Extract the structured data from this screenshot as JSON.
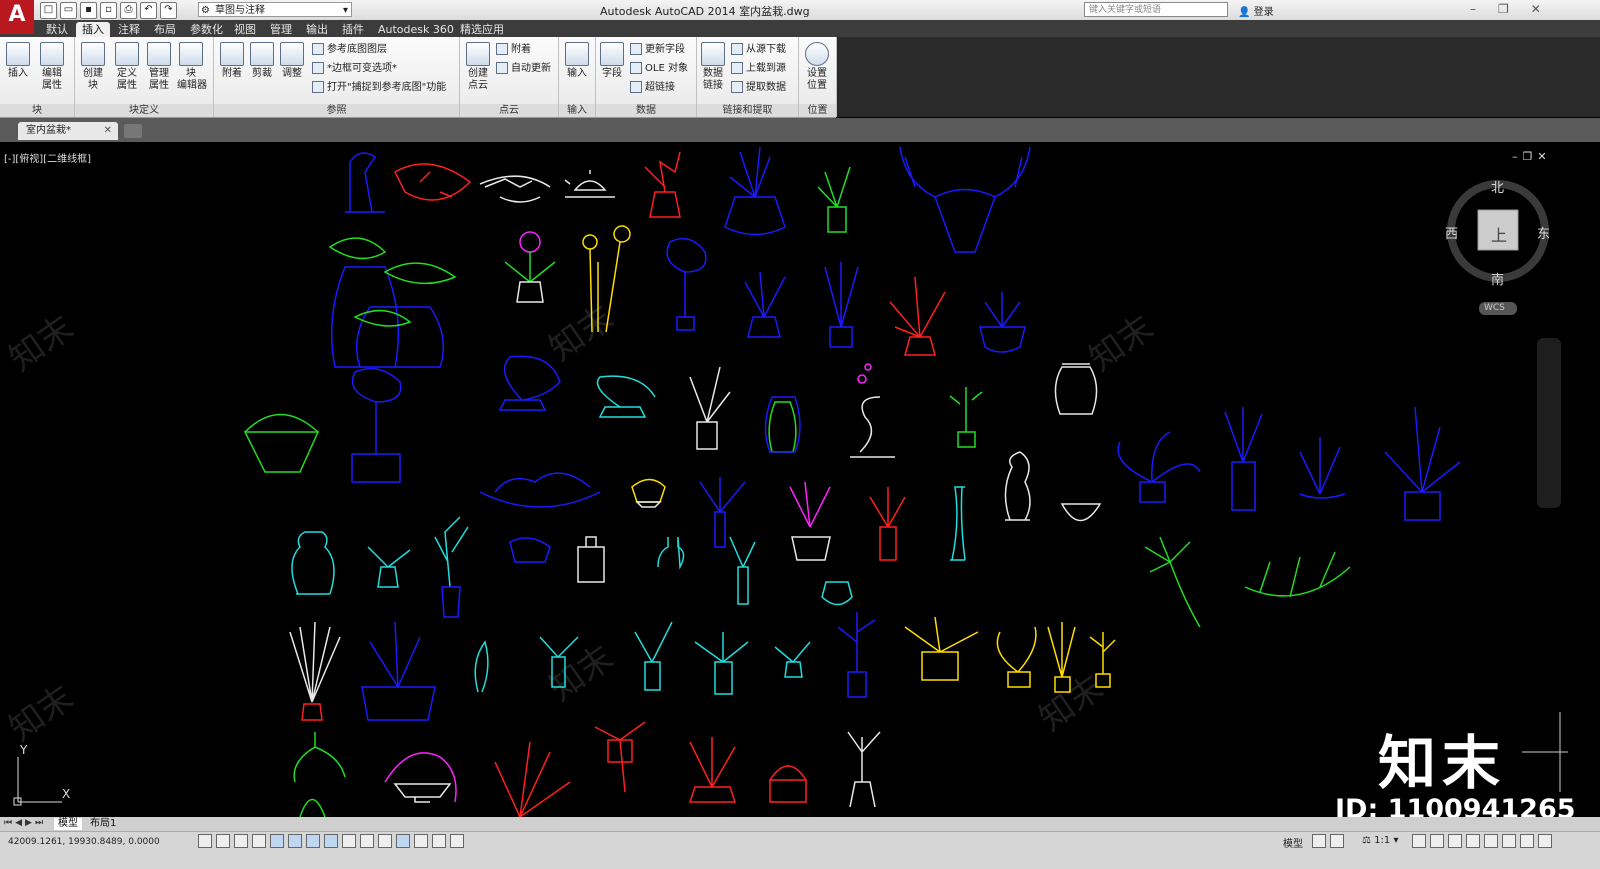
{
  "app": {
    "logo": "A",
    "workspace": "草图与注释",
    "window_title": "Autodesk AutoCAD 2014    室内盆栽.dwg",
    "search_placeholder": "键入关键字或短语",
    "login": "登录"
  },
  "ribbon_tabs": [
    "默认",
    "插入",
    "注释",
    "布局",
    "参数化",
    "视图",
    "管理",
    "输出",
    "插件",
    "Autodesk 360",
    "精选应用"
  ],
  "active_tab": "插入",
  "panels": {
    "block": {
      "label": "块",
      "buttons": [
        "插入",
        "编辑\n属性"
      ]
    },
    "block_def": {
      "label": "块定义",
      "buttons": [
        "创建\n块",
        "定义\n属性",
        "管理\n属性",
        "块\n编辑器"
      ]
    },
    "reference": {
      "label": "参照",
      "buttons": [
        "附着",
        "剪裁",
        "调整"
      ],
      "small": [
        "参考底图图层",
        "*边框可变选项*",
        "打开\"捕捉到参考底图\"功能"
      ]
    },
    "pointcloud": {
      "label": "点云",
      "buttons": [
        "创建\n点云"
      ],
      "small": [
        "附着",
        "自动更新"
      ]
    },
    "import": {
      "label": "输入",
      "buttons": [
        "输入"
      ]
    },
    "data": {
      "label": "数据",
      "buttons": [
        "字段"
      ],
      "small": [
        "更新字段",
        "OLE 对象",
        "超链接"
      ]
    },
    "linking": {
      "label": "链接和提取",
      "buttons": [
        "数据\n链接"
      ],
      "small": [
        "从源下载",
        "上载到源",
        "提取数据"
      ]
    },
    "location": {
      "label": "位置",
      "buttons": [
        "设置\n位置"
      ]
    }
  },
  "document_tab": "室内盆栽*",
  "viewport": {
    "label": "[-][俯视][二维线框]",
    "compass": {
      "north": "北",
      "south": "南",
      "east": "东",
      "west": "西",
      "top": "上"
    },
    "wcs": "WCS",
    "ucs_y": "Y",
    "ucs_x": "X"
  },
  "layout_tabs": [
    "模型",
    "布局1"
  ],
  "status": {
    "coords": "42009.1261,  19930.8489,  0.0000",
    "model": "模型",
    "scale": "1:1"
  },
  "watermark": {
    "brand": "知末",
    "id": "ID: 1100941265"
  },
  "colors": {
    "blue": "#1a1aff",
    "red": "#ff2020",
    "green": "#22dd22",
    "cyan": "#22dddd",
    "yellow": "#ffdd00",
    "magenta": "#ff22ff",
    "white": "#e8e8e8"
  }
}
